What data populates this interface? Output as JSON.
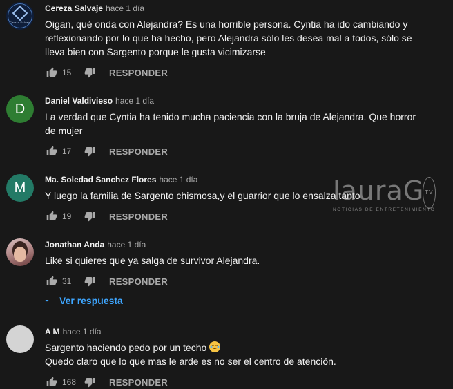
{
  "comments": [
    {
      "author": "Cereza Salvaje",
      "time": "hace 1 día",
      "avatar_text": "Cereza Salvaje",
      "lines": [
        "Oigan, qué onda con Alejandra? Es una horrible persona. Cyntia ha ido cambiando y",
        "reflexionando por lo que ha hecho, pero Alejandra sólo les desea mal a todos, sólo se",
        "lleva bien con Sargento porque le gusta vicimizarse"
      ],
      "likes": "15",
      "reply_label": "RESPONDER"
    },
    {
      "author": "Daniel Valdivieso",
      "time": "hace 1 día",
      "avatar_letter": "D",
      "lines": [
        "La verdad que Cyntia ha tenido mucha paciencia con la bruja de Alejandra. Que horror",
        "de mujer"
      ],
      "likes": "17",
      "reply_label": "RESPONDER"
    },
    {
      "author": "Ma. Soledad Sanchez Flores",
      "time": "hace 1 día",
      "avatar_letter": "M",
      "lines": [
        "Y luego la familia de Sargento chismosa,y el guarrior que lo ensalza tanto"
      ],
      "likes": "19",
      "reply_label": "RESPONDER"
    },
    {
      "author": "Jonathan Anda",
      "time": "hace 1 día",
      "lines": [
        "Like si quieres que ya salga de survivor Alejandra."
      ],
      "likes": "31",
      "reply_label": "RESPONDER",
      "view_replies": "Ver respuesta"
    },
    {
      "author": "A M",
      "time": "hace 1 día",
      "lines": [
        "Sargento haciendo pedo por un techo",
        "Quedo claro que lo que mas le arde es no ser el centro de atención."
      ],
      "emoji": "face-with-tears-of-joy",
      "likes": "168",
      "reply_label": "RESPONDER"
    }
  ],
  "watermark": {
    "logo": "lauraG",
    "badge": "TV",
    "tagline": "NOTICIAS DE ENTRETENIMIENTO"
  },
  "icons": {
    "like": "thumbs-up-icon",
    "dislike": "thumbs-down-icon",
    "expand": "caret-down-icon"
  },
  "colors": {
    "background": "#181818",
    "text": "#f1f1f1",
    "secondary": "#aaaaaa",
    "link": "#3ea6ff",
    "avatar_daniel": "#2e7d32",
    "avatar_soledad": "#237a66"
  }
}
